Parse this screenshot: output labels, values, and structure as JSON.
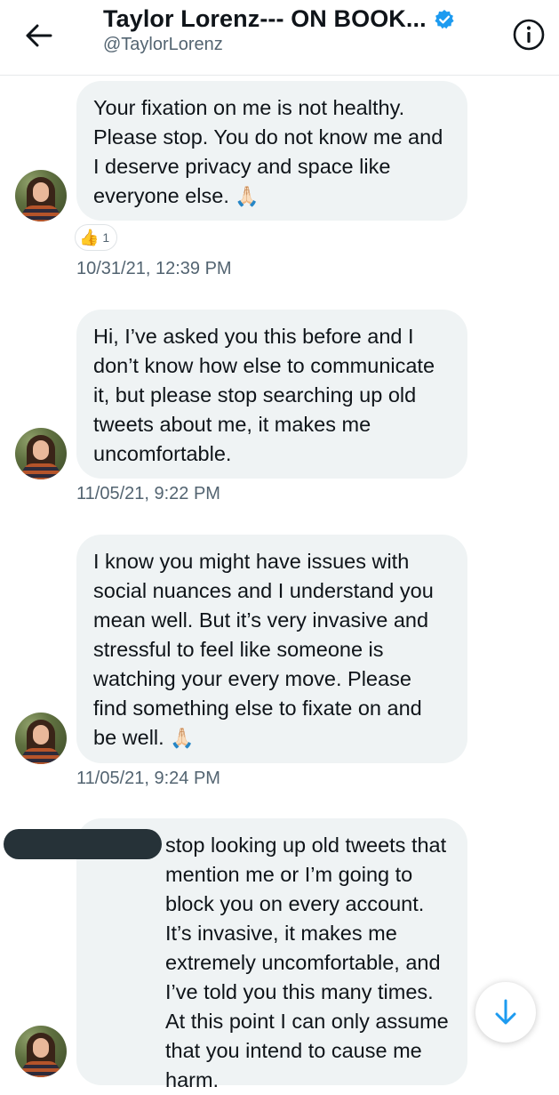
{
  "header": {
    "title": "Taylor Lorenz--- ON BOOK...",
    "handle": "@TaylorLorenz",
    "back_icon": "arrow-left-icon",
    "verified_icon": "verified-badge-icon",
    "info_icon": "info-icon"
  },
  "messages": [
    {
      "text": "Your fixation on me is not healthy. Please stop. You do not know me and I deserve privacy and space like everyone else.",
      "emoji": "🙏🏻",
      "reaction": {
        "emoji": "👍",
        "count": "1"
      },
      "timestamp": "10/31/21, 12:39 PM"
    },
    {
      "text": "Hi, I’ve asked you this before and I don’t know how else to communicate it, but please stop searching up old tweets about me, it makes me uncomfortable.",
      "timestamp": "11/05/21, 9:22 PM"
    },
    {
      "text": "I know you might have issues with social nuances and I understand you mean well. But it’s very invasive and stressful to feel like someone is watching your every move. Please find something else to fixate on and be well.",
      "emoji": "🙏🏻",
      "timestamp": "11/05/21, 9:24 PM"
    },
    {
      "text": "stop looking up old tweets that mention me or I’m going to block you on every account. It’s invasive, it makes me extremely uncomfortable, and I’ve told you this many times. At this point I can only assume that you intend to cause me harm."
    }
  ],
  "scroll_button": {
    "icon": "arrow-down-icon"
  },
  "colors": {
    "bubble": "#eff3f4",
    "timestamp": "#536471",
    "accent": "#1d9bf0",
    "redaction": "#263238"
  }
}
